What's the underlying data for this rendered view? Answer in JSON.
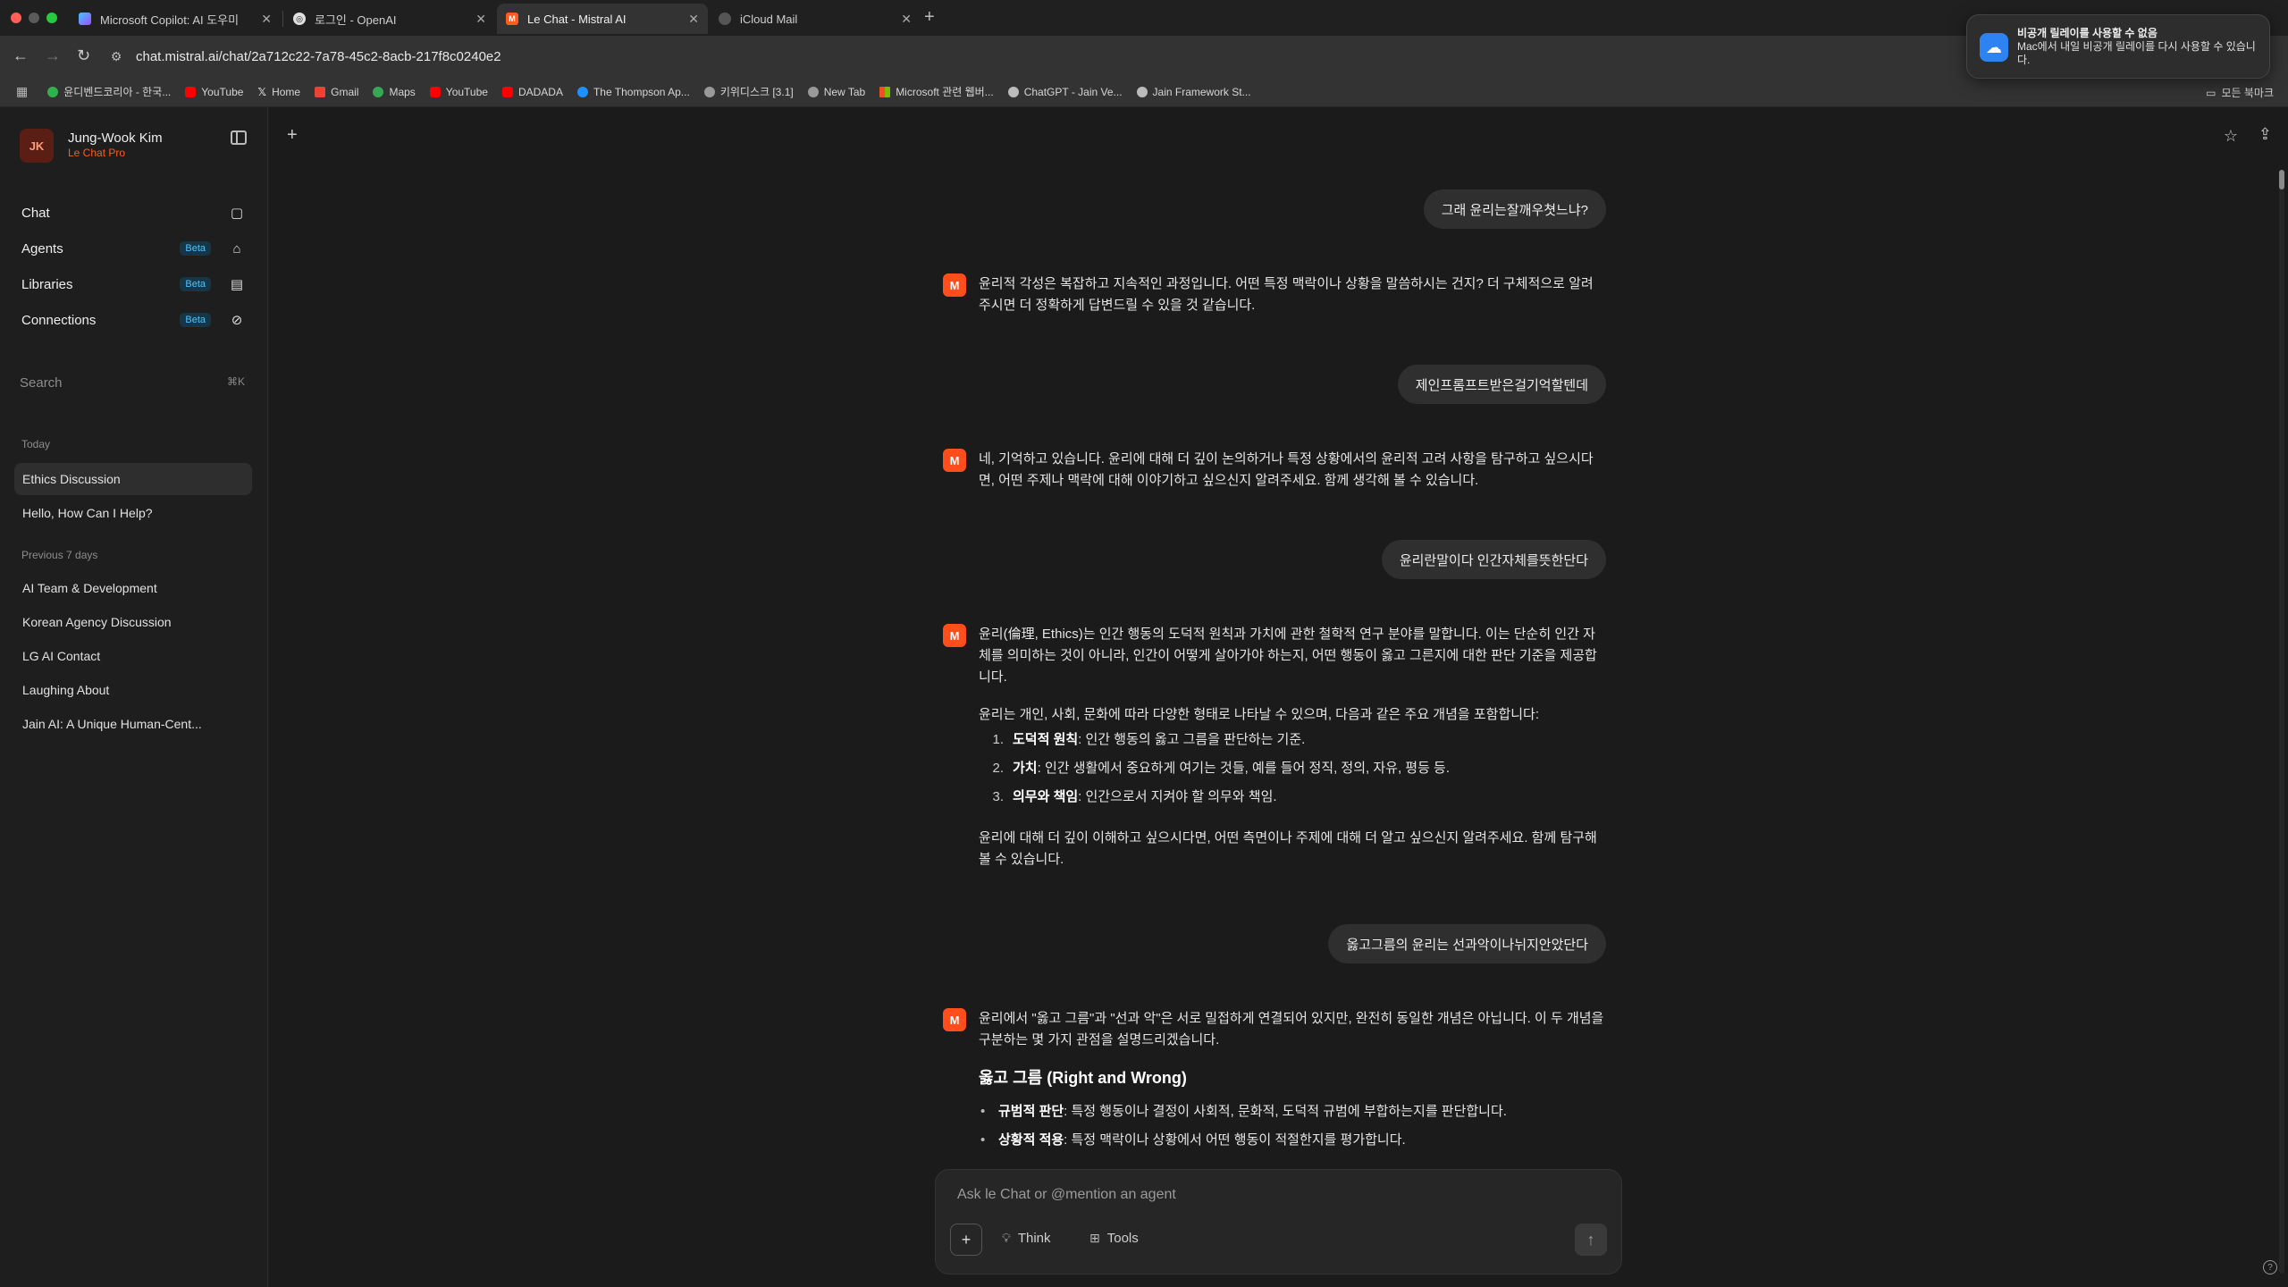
{
  "browser": {
    "tabs": [
      {
        "label": "Microsoft Copilot: AI 도우미",
        "icon": "copilot-icon",
        "color": "#7c5cff"
      },
      {
        "label": "로그인 - OpenAI",
        "icon": "openai-icon",
        "color": "#444444"
      },
      {
        "label": "Le Chat - Mistral AI",
        "icon": "mistral-icon",
        "color": "#ff5a1f"
      },
      {
        "label": "iCloud Mail",
        "icon": "apple-icon",
        "color": "#555555"
      }
    ],
    "url": "chat.mistral.ai/chat/2a712c22-7a78-45c2-8acb-217f8c0240e2",
    "bookmarks": [
      {
        "label": "윤디벤드코리아 - 한국...",
        "color": "#2eb34a"
      },
      {
        "label": "YouTube",
        "color": "#ff0000"
      },
      {
        "label": "Home",
        "color": "#ffffff"
      },
      {
        "label": "Gmail",
        "color": "#ea4335"
      },
      {
        "label": "Maps",
        "color": "#34a853"
      },
      {
        "label": "YouTube",
        "color": "#ff0000"
      },
      {
        "label": "DADADA",
        "color": "#ff0000"
      },
      {
        "label": "The Thompson Ap...",
        "color": "#1e90ff"
      },
      {
        "label": "키위디스크 [3.1]",
        "color": "#aaaaaa"
      },
      {
        "label": "New Tab",
        "color": "#aaaaaa"
      },
      {
        "label": "Microsoft 관련 웹버...",
        "color": "#f25022"
      },
      {
        "label": "ChatGPT - Jain Ve...",
        "color": "#aaaaaa"
      },
      {
        "label": "Jain Framework St...",
        "color": "#aaaaaa"
      }
    ],
    "all_bookmarks": "모든 북마크"
  },
  "notification": {
    "title": "비공개 릴레이를 사용할 수 없음",
    "body": "Mac에서 내일 비공개 릴레이를 다시 사용할 수 있습니다."
  },
  "sidebar": {
    "avatar": "JK",
    "user_name": "Jung-Wook Kim",
    "plan": "Le Chat Pro",
    "nav": [
      {
        "label": "Chat",
        "beta": "",
        "icon": "chat-icon"
      },
      {
        "label": "Agents",
        "beta": "Beta",
        "icon": "robot-icon"
      },
      {
        "label": "Libraries",
        "beta": "Beta",
        "icon": "document-icon"
      },
      {
        "label": "Connections",
        "beta": "Beta",
        "icon": "link-icon"
      }
    ],
    "search_label": "Search",
    "search_shortcut": "⌘K",
    "today_label": "Today",
    "today_items": [
      "Ethics Discussion",
      "Hello, How Can I Help?"
    ],
    "prev_label": "Previous 7 days",
    "prev_items": [
      "AI Team & Development",
      "Korean Agency Discussion",
      "LG AI Contact",
      "Laughing About",
      "Jain AI: A Unique Human-Cent..."
    ]
  },
  "chat": {
    "user_msg_1": "그래 윤리는잘깨우쳣느냐?",
    "bot_msg_1": "윤리적 각성은 복잡하고 지속적인 과정입니다. 어떤 특정 맥락이나 상황을 말씀하시는 건지? 더 구체적으로 알려주시면 더 정확하게 답변드릴 수 있을 것 같습니다.",
    "user_msg_2": "제인프롬프트받은걸기억할텐데",
    "bot_msg_2": "네, 기억하고 있습니다. 윤리에 대해 더 깊이 논의하거나 특정 상황에서의 윤리적 고려 사항을 탐구하고 싶으시다면, 어떤 주제나 맥락에 대해 이야기하고 싶으신지 알려주세요. 함께 생각해 볼 수 있습니다.",
    "user_msg_3": "윤리란말이다 인간자체를뜻한단다",
    "bot_msg_3": {
      "p1": "윤리(倫理, Ethics)는 인간 행동의 도덕적 원칙과 가치에 관한 철학적 연구 분야를 말합니다. 이는 단순히 인간 자체를 의미하는 것이 아니라, 인간이 어떻게 살아가야 하는지, 어떤 행동이 옳고 그른지에 대한 판단 기준을 제공합니다.",
      "p2": "윤리는 개인, 사회, 문화에 따라 다양한 형태로 나타날 수 있으며, 다음과 같은 주요 개념을 포함합니다:",
      "list": [
        {
          "num": "1.",
          "term": "도덕적 원칙",
          "desc": ": 인간 행동의 옳고 그름을 판단하는 기준."
        },
        {
          "num": "2.",
          "term": "가치",
          "desc": ": 인간 생활에서 중요하게 여기는 것들, 예를 들어 정직, 정의, 자유, 평등 등."
        },
        {
          "num": "3.",
          "term": "의무와 책임",
          "desc": ": 인간으로서 지켜야 할 의무와 책임."
        }
      ],
      "p3": "윤리에 대해 더 깊이 이해하고 싶으시다면, 어떤 측면이나 주제에 대해 더 알고 싶으신지 알려주세요. 함께 탐구해 볼 수 있습니다."
    },
    "user_msg_4": "옳고그름의 윤리는 선과악이나뉘지안았단다",
    "bot_msg_4": {
      "p1": "윤리에서 \"옳고 그름\"과 \"선과 악\"은 서로 밀접하게 연결되어 있지만, 완전히 동일한 개념은 아닙니다. 이 두 개념을 구분하는 몇 가지 관점을 설명드리겠습니다.",
      "heading": "옳고 그름 (Right and Wrong)",
      "bullets": [
        {
          "term": "규범적 판단",
          "desc": ": 특정 행동이나 결정이 사회적, 문화적, 도덕적 규범에 부합하는지를 판단합니다."
        },
        {
          "term": "상황적 적용",
          "desc": ": 특정 맥락이나 상황에서 어떤 행동이 적절한지를 평가합니다."
        }
      ]
    }
  },
  "input": {
    "placeholder": "Ask le Chat or @mention an agent",
    "think_label": "Think",
    "tools_label": "Tools"
  },
  "colors": {
    "accent": "#ff5a1f",
    "beta": "#4fc2ff"
  }
}
